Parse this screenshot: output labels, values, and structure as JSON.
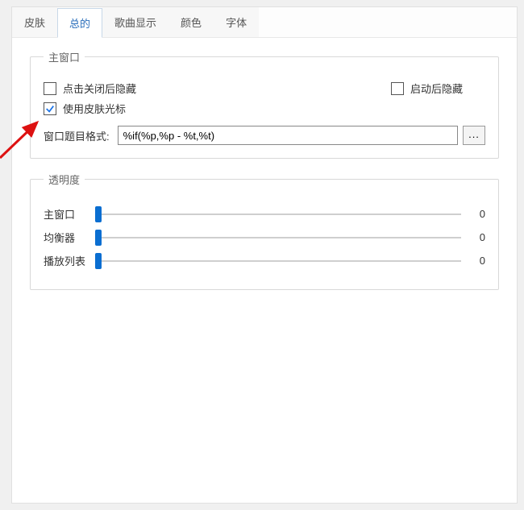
{
  "tabs": {
    "skin": "皮肤",
    "general": "总的",
    "song_display": "歌曲显示",
    "color": "颜色",
    "font": "字体",
    "active": "general"
  },
  "main_window_group": {
    "legend": "主窗口",
    "hide_on_close": {
      "label": "点击关闭后隐藏",
      "checked": false
    },
    "hide_after_launch": {
      "label": "启动后隐藏",
      "checked": false
    },
    "use_skin_cursor": {
      "label": "使用皮肤光标",
      "checked": true
    },
    "title_format": {
      "label": "窗口题目格式:",
      "value": "%if(%p,%p - %t,%t)",
      "button": "..."
    }
  },
  "transparency_group": {
    "legend": "透明度",
    "sliders": [
      {
        "label": "主窗口",
        "value": 0
      },
      {
        "label": "均衡器",
        "value": 0
      },
      {
        "label": "播放列表",
        "value": 0
      }
    ]
  }
}
